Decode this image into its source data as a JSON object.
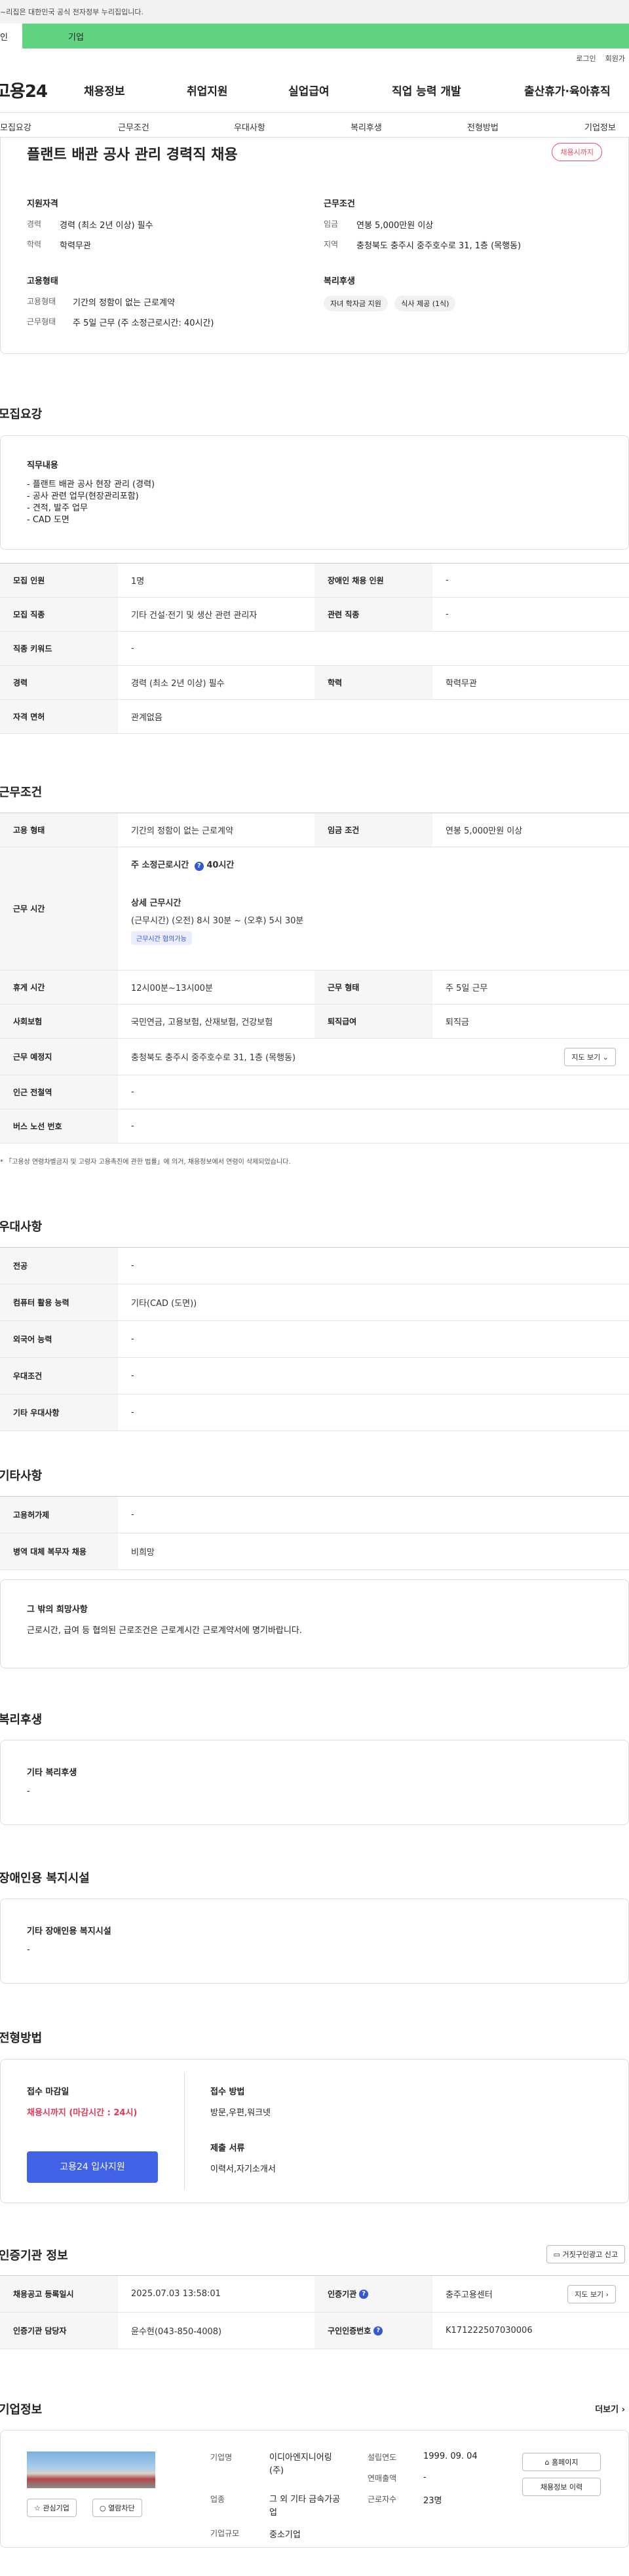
{
  "gov_banner": "~리집은 대한민국 공식 전자정부 누리집입니다.",
  "tabs": {
    "personal": "인",
    "company": "기업"
  },
  "util": {
    "login": "로그인",
    "signup": "회원가"
  },
  "nav": {
    "logo": "고용24",
    "items": [
      "채용정보",
      "취업지원",
      "실업급여",
      "직업 능력 개발",
      "출산휴가·육아휴직"
    ]
  },
  "anchors": [
    "모집요강",
    "근무조건",
    "우대사항",
    "복리후생",
    "전형방법",
    "기업정보"
  ],
  "summary": {
    "title": "플랜트 배관 공사 관리 경력직 채용",
    "deadline_pill": "채용시까지",
    "qual": {
      "head": "지원자격",
      "rows": [
        {
          "k": "경력",
          "v": "경력 (최소 2년 이상) 필수"
        },
        {
          "k": "학력",
          "v": "학력무관"
        }
      ]
    },
    "work": {
      "head": "근무조건",
      "rows": [
        {
          "k": "임금",
          "v": "연봉 5,000만원 이상"
        },
        {
          "k": "지역",
          "v": "충청북도 충주시 중주호수로 31, 1층 (목행동)"
        }
      ]
    },
    "emp": {
      "head": "고용형태",
      "rows": [
        {
          "k": "고용형태",
          "v": "기간의 정함이 없는 근로계약"
        },
        {
          "k": "근무형태",
          "v": "주 5일 근무 (주 소정근로시간: 40시간)"
        }
      ]
    },
    "welfare": {
      "head": "복리후생",
      "chips": [
        "자녀 학자금 지원",
        "식사 제공 (1식)"
      ]
    }
  },
  "recruit": {
    "heading": "모집요강",
    "duty_title": "직무내용",
    "duties": [
      "- 플랜트 배관 공사 현장 관리 (경력)",
      "- 공사 관련 업무(현장관리포함)",
      "- 견적, 발주 업무",
      "- CAD 도면"
    ],
    "table": {
      "r1": {
        "k1": "모집 인원",
        "v1": "1명",
        "k2": "장애인 채용 인원",
        "v2": "-"
      },
      "r2": {
        "k1": "모집 직종",
        "v1": "기타 건설·전기 및 생산 관련 관리자",
        "k2": "관련 직종",
        "v2": "-"
      },
      "r3": {
        "k1": "직종 키워드",
        "v1": "-"
      },
      "r4": {
        "k1": "경력",
        "v1": "경력 (최소 2년 이상) 필수",
        "k2": "학력",
        "v2": "학력무관"
      },
      "r5": {
        "k1": "자격 면허",
        "v1": "관계없음"
      }
    }
  },
  "conditions": {
    "heading": "근무조건",
    "r1": {
      "k1": "고용 형태",
      "v1": "기간의 정함이 없는 근로계약",
      "k2": "임금 조건",
      "v2": "연봉 5,000만원 이상"
    },
    "hours": {
      "k": "근무 시간",
      "weekly": "주 소정근로시간",
      "weekly_val": "40시간",
      "detail_title": "상세 근무시간",
      "detail": "(근무시간) (오전) 8시 30분 ~ (오후) 5시 30분",
      "tag": "근무시간 협의가능"
    },
    "r3": {
      "k1": "휴게 시간",
      "v1": "12시00분~13시00분",
      "k2": "근무 형태",
      "v2": "주 5일 근무"
    },
    "r4": {
      "k1": "사회보험",
      "v1": "국민연금, 고용보험, 산재보험, 건강보험",
      "k2": "퇴직급여",
      "v2": "퇴직금"
    },
    "r5": {
      "k1": "근무 예정지",
      "v1": "충청북도 충주시 중주호수로 31, 1층 (목행동)",
      "btn": "지도 보기"
    },
    "r6": {
      "k1": "인근 전철역",
      "v1": "-"
    },
    "r7": {
      "k1": "버스 노선 번호",
      "v1": "-"
    },
    "note": "* 「고용상 연령차별금지 및 고령자 고용촉진에 관한 법률」에 의거, 채용정보에서 연령이 삭제되었습니다."
  },
  "preference": {
    "heading": "우대사항",
    "rows": [
      {
        "k": "전공",
        "v": "-"
      },
      {
        "k": "컴퓨터 활용 능력",
        "v": "기타(CAD (도면))"
      },
      {
        "k": "외국어 능력",
        "v": "-"
      },
      {
        "k": "우대조건",
        "v": "-"
      },
      {
        "k": "기타 우대사항",
        "v": "-"
      }
    ]
  },
  "other": {
    "heading": "기타사항",
    "rows": [
      {
        "k": "고용허가제",
        "v": "-"
      },
      {
        "k": "병역 대체 복무자 채용",
        "v": "비희망"
      }
    ],
    "wish_title": "그 밖의 희망사항",
    "wish_text": "근로시간, 급여 등 협의된 근로조건은 근로계시간 근로계약서에 명기바랍니다."
  },
  "welfare": {
    "heading": "복리후생",
    "title": "기타 복리후생",
    "value": "-"
  },
  "disabled": {
    "heading": "장애인용 복지시설",
    "title": "기타 장애인용 복지시설",
    "value": "-"
  },
  "selection": {
    "heading": "전형방법",
    "deadline_title": "접수 마감일",
    "deadline_val": "채용시까지 (마감시간 : 24시)",
    "apply_btn": "고용24 입사지원",
    "method_title": "접수 방법",
    "method_val": "방문,우편,워크넷",
    "docs_title": "제출 서류",
    "docs_val": "이력서,자기소개서"
  },
  "agency": {
    "heading": "인증기관 정보",
    "report_btn": "거짓구인광고 신고",
    "r1": {
      "k1": "채용공고 등록일시",
      "v1": "2025.07.03 13:58:01",
      "k2": "인증기관",
      "v2": "충주고용센터",
      "btn": "지도 보기"
    },
    "r2": {
      "k1": "인증기관 담당자",
      "v1": "윤수현(043-850-4008)",
      "k2": "구인인증번호",
      "v2": "K171222507030006"
    }
  },
  "company": {
    "heading": "기업정보",
    "more": "더보기",
    "fav_btn": "관심기업",
    "block_btn": "열람차단",
    "name_k": "기업명",
    "name_v": "이디아엔지니어링(주)",
    "industry_k": "업종",
    "industry_v": "그 외 기타 금속가공업",
    "size_k": "기업규모",
    "size_v": "중소기업",
    "est_k": "설립연도",
    "est_v": "1999. 09. 04",
    "sales_k": "연매출액",
    "sales_v": "-",
    "emp_k": "근로자수",
    "emp_v": "23명",
    "homepage_btn": "홈페이지",
    "history_btn": "채용정보 이력"
  }
}
